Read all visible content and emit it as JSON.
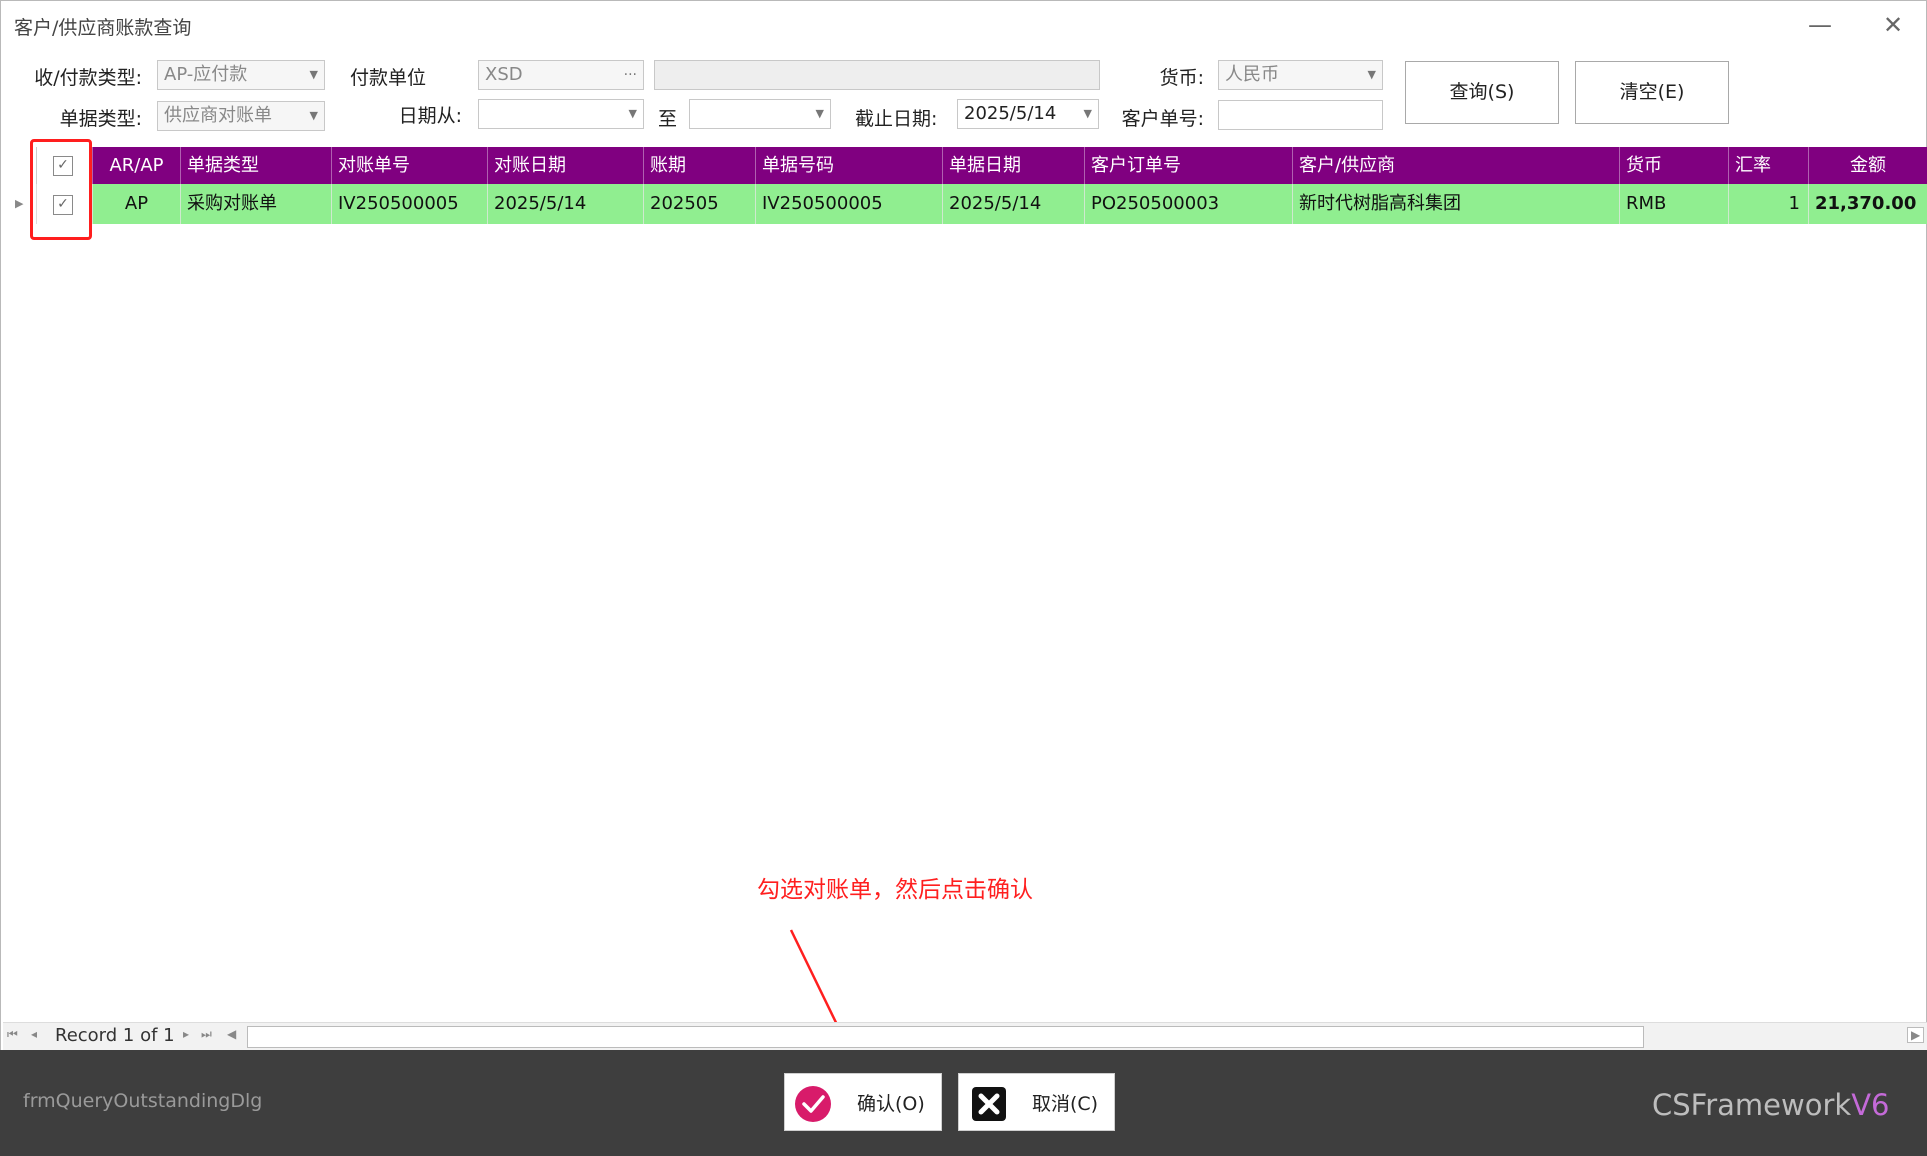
{
  "window": {
    "title": "客户/供应商账款查询",
    "minimize": "—",
    "close": "✕"
  },
  "filters": {
    "pay_type_label": "收/付款类型:",
    "pay_type_value": "AP-应付款",
    "pay_unit_label": "付款单位",
    "pay_unit_value": "XSD",
    "pay_unit_ellipsis": "···",
    "currency_label": "货币:",
    "currency_value": "人民币",
    "doc_type_label": "单据类型:",
    "doc_type_value": "供应商对账单",
    "date_from_label": "日期从:",
    "date_to_label": "至",
    "cutoff_label": "截止日期:",
    "cutoff_value": "2025/5/14",
    "customer_no_label": "客户单号:",
    "query_button": "查询(S)",
    "clear_button": "清空(E)"
  },
  "grid": {
    "columns": [
      "AR/AP",
      "单据类型",
      "对账单号",
      "对账日期",
      "账期",
      "单据号码",
      "单据日期",
      "客户订单号",
      "客户/供应商",
      "货币",
      "汇率",
      "金额"
    ],
    "rows": [
      [
        "AP",
        "采购对账单",
        "IV250500005",
        "2025/5/14",
        "202505",
        "IV250500005",
        "2025/5/14",
        "PO250500003",
        "新时代树脂高科集团",
        "RMB",
        "1",
        "21,370.00"
      ]
    ]
  },
  "annotation": {
    "text": "勾选对账单，然后点击确认",
    "color": "#ff1f1f"
  },
  "navigator": {
    "record_text": "Record 1 of 1"
  },
  "footer": {
    "form_name": "frmQueryOutstandingDlg",
    "confirm_button": "确认(O)",
    "cancel_button": "取消(C)",
    "brand_main": "CSFramework",
    "brand_version": "V6"
  },
  "colors": {
    "header_bg": "#800080",
    "row_bg": "#90ee90",
    "footer_bg": "#3e3e3e",
    "confirm_icon": "#d81b6a"
  }
}
